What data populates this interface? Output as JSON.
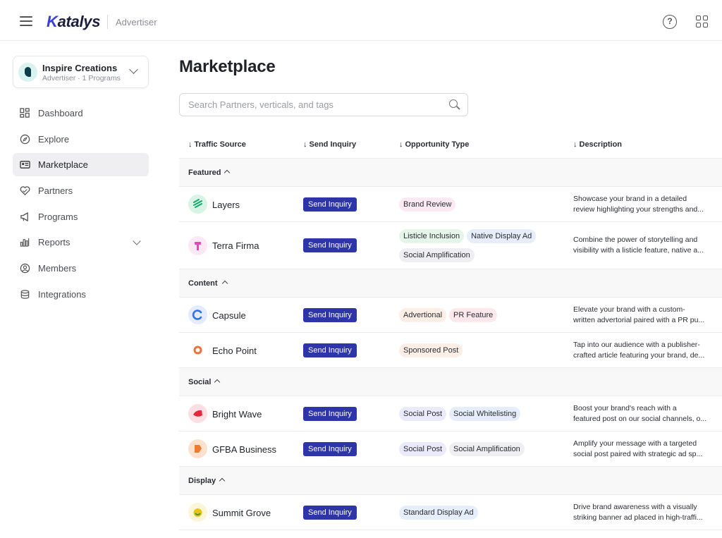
{
  "header": {
    "brand": "Katalys",
    "brand_k": "K",
    "brand_rest": "atalys",
    "role": "Advertiser"
  },
  "account": {
    "name": "Inspire Creations",
    "subtitle": "Advertiser · 1 Programs"
  },
  "sidebar": {
    "items": [
      {
        "label": "Dashboard",
        "icon": "dashboard-icon"
      },
      {
        "label": "Explore",
        "icon": "compass-icon"
      },
      {
        "label": "Marketplace",
        "icon": "marketplace-icon",
        "active": true
      },
      {
        "label": "Partners",
        "icon": "partners-icon"
      },
      {
        "label": "Programs",
        "icon": "megaphone-icon"
      },
      {
        "label": "Reports",
        "icon": "bar-chart-icon",
        "expandable": true
      },
      {
        "label": "Members",
        "icon": "user-circle-icon"
      },
      {
        "label": "Integrations",
        "icon": "integrations-icon"
      }
    ]
  },
  "main": {
    "title": "Marketplace",
    "search_placeholder": "Search Partners, verticals, and tags",
    "columns": {
      "traffic_source": "Traffic Source",
      "send_inquiry": "Send Inquiry",
      "opportunity_type": "Opportunity Type",
      "description": "Description"
    },
    "groups": {
      "featured": "Featured",
      "content": "Content",
      "social": "Social",
      "display": "Display"
    },
    "rows": [
      {
        "partner": "Layers",
        "inquiry": "Send Inquiry",
        "tags": [
          "Brand Review"
        ],
        "desc1": "Showcase your brand in a detailed",
        "desc2": "review highlighting your strengths and..."
      },
      {
        "partner": "Terra Firma",
        "inquiry": "Send Inquiry",
        "tags": [
          "Listicle Inclusion",
          "Native Display Ad",
          "Social Amplification"
        ],
        "desc1": "Combine the power of storytelling and",
        "desc2": "visibility with a listicle feature, native a..."
      },
      {
        "partner": "Capsule",
        "inquiry": "Send Inquiry",
        "tags": [
          "Advertional",
          "PR Feature"
        ],
        "desc1": "Elevate your brand with a custom-",
        "desc2": "written advertorial paired with a PR pu..."
      },
      {
        "partner": "Echo Point",
        "inquiry": "Send Inquiry",
        "tags": [
          "Sponsored Post"
        ],
        "desc1": "Tap into our audience with a publisher-",
        "desc2": "crafted article featuring your brand, de..."
      },
      {
        "partner": "Bright Wave",
        "inquiry": "Send Inquiry",
        "tags": [
          "Social Post",
          "Social Whitelisting"
        ],
        "desc1": "Boost your brand's reach with a",
        "desc2": "featured post on our social channels, o..."
      },
      {
        "partner": "GFBA Business",
        "inquiry": "Send Inquiry",
        "tags": [
          "Social Post",
          "Social Amplification"
        ],
        "desc1": "Amplify your message with a targeted",
        "desc2": "social post paired with strategic ad sp..."
      },
      {
        "partner": "Summit Grove",
        "inquiry": "Send Inquiry",
        "tags": [
          "Standard Display Ad"
        ],
        "desc1": "Drive brand awareness with a visually",
        "desc2": "striking banner ad placed in high-traffi..."
      }
    ]
  },
  "colors": {
    "accent": "#2d35a8",
    "tag_review": "#fbe9f3",
    "tag_listicle": "#e6f5ea",
    "tag_native": "#e6eefb",
    "tag_social_amp": "#efeff1",
    "tag_advertorial": "#fdeee6",
    "tag_pr": "#fde8ec",
    "tag_sponsored": "#fdeee6",
    "tag_social_post": "#ebeafb",
    "tag_whitelisting": "#e6eefb",
    "tag_display": "#e6eefb"
  }
}
